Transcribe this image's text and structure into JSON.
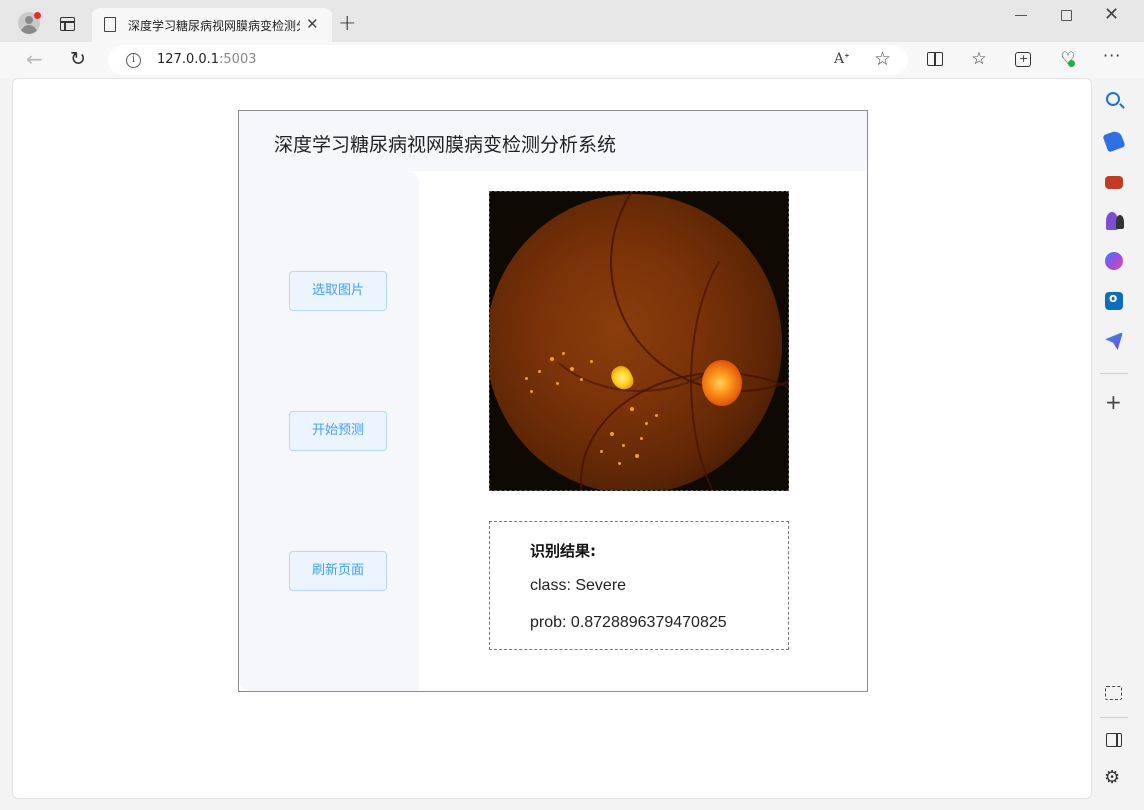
{
  "browser": {
    "tab_title": "深度学习糖尿病视网膜病变检测分",
    "url_host": "127.0.0.1",
    "url_port": ":5003",
    "read_aloud_label": "A)"
  },
  "app": {
    "title": "深度学习糖尿病视网膜病变检测分析系统",
    "buttons": {
      "select": "选取图片",
      "predict": "开始预测",
      "refresh": "刷新页面"
    },
    "result": {
      "heading": "识别结果:",
      "class_line": "class: Severe",
      "prob_line": "prob: 0.8728896379470825"
    }
  },
  "icons": {
    "profile": "profile-icon",
    "tabs": "tab-actions-icon",
    "page": "document-icon",
    "close": "close-icon",
    "new_tab": "plus-icon",
    "back": "back-arrow-icon",
    "reload": "reload-icon",
    "site_info": "info-icon",
    "read_aloud": "read-aloud-icon",
    "favorite": "star-icon",
    "split": "split-screen-icon",
    "favorites": "favorites-icon",
    "collections": "collections-icon",
    "health": "browser-essentials-icon",
    "more": "more-icon"
  },
  "colors": {
    "button_bg": "#ecf5ff",
    "button_border": "#b3d8ff",
    "button_text": "#409eff",
    "panel_bg": "#f5f7fa"
  }
}
